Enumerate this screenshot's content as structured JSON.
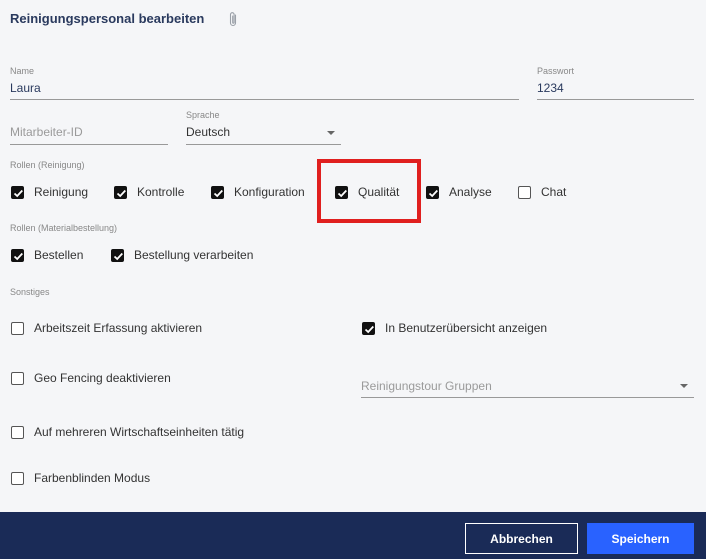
{
  "dialog": {
    "title": "Reinigungspersonal bearbeiten",
    "attachment_icon": "paperclip-icon"
  },
  "form": {
    "name": {
      "label": "Name",
      "value": "Laura"
    },
    "password": {
      "label": "Passwort",
      "value": "1234"
    },
    "employee_id": {
      "placeholder": "Mitarbeiter-ID"
    },
    "language": {
      "label": "Sprache",
      "value": "Deutsch"
    },
    "cleaning_tour": {
      "placeholder": "Reinigungstour Gruppen"
    }
  },
  "roles_cleaning": {
    "label": "Rollen (Reinigung)",
    "items": [
      {
        "label": "Reinigung",
        "checked": true
      },
      {
        "label": "Kontrolle",
        "checked": true
      },
      {
        "label": "Konfiguration",
        "checked": true
      },
      {
        "label": "Qualität",
        "checked": true
      },
      {
        "label": "Analyse",
        "checked": true
      },
      {
        "label": "Chat",
        "checked": false
      }
    ]
  },
  "roles_material": {
    "label": "Rollen (Materialbestellung)",
    "items": [
      {
        "label": "Bestellen",
        "checked": true
      },
      {
        "label": "Bestellung verarbeiten",
        "checked": true
      }
    ]
  },
  "misc": {
    "label": "Sonstiges",
    "items": [
      {
        "label": "Arbeitszeit Erfassung aktivieren",
        "checked": false
      },
      {
        "label": "In Benutzerübersicht anzeigen",
        "checked": true
      },
      {
        "label": "Geo Fencing deaktivieren",
        "checked": false
      },
      {
        "label": "Auf mehreren Wirtschaftseinheiten tätig",
        "checked": false
      },
      {
        "label": "Farbenblinden Modus",
        "checked": false
      }
    ]
  },
  "footer": {
    "cancel_label": "Abbrechen",
    "save_label": "Speichern"
  },
  "colors": {
    "footer_bg": "#1a2b57",
    "primary": "#2962ff",
    "highlight": "#e01f1f"
  }
}
